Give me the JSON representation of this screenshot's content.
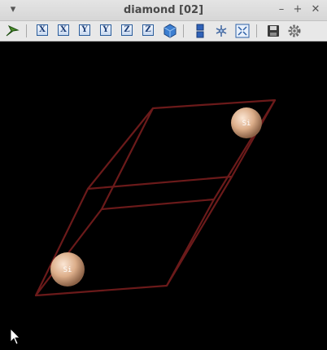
{
  "window": {
    "title": "diamond [02]",
    "menu_glyph": "▾",
    "minimize_glyph": "–",
    "maximize_glyph": "+",
    "close_glyph": "✕"
  },
  "toolbar": {
    "axis_buttons": [
      "X",
      "X",
      "Y",
      "Y",
      "Z",
      "Z"
    ],
    "icons": [
      "pointer-icon",
      "cube-icon",
      "layers-icon",
      "rotate-icon",
      "fit-screen-icon",
      "save-icon",
      "settings-icon"
    ]
  },
  "scene": {
    "cell_color": "#6b1a1a",
    "atom_color": "#e2b28f",
    "atoms": [
      {
        "label": "Si"
      },
      {
        "label": "Si"
      }
    ]
  },
  "cursor": "arrow"
}
